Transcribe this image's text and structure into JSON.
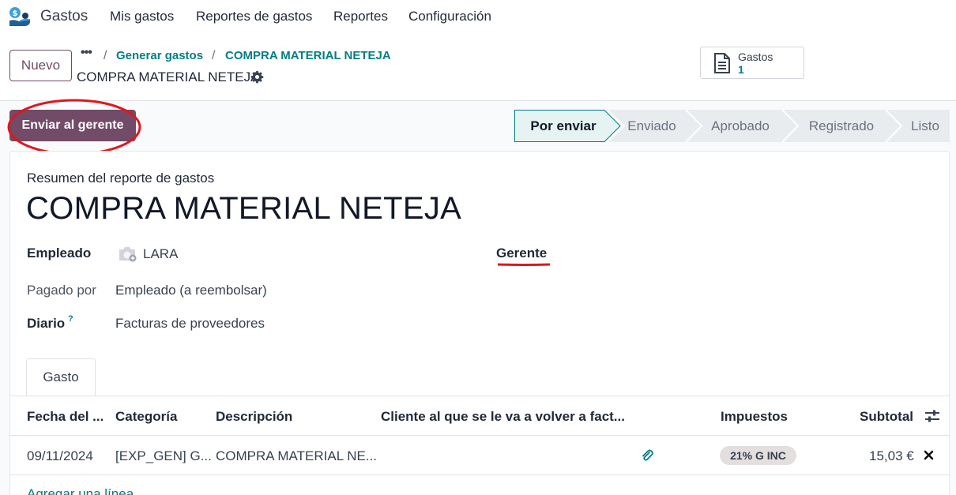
{
  "navbar": {
    "app_name": "Gastos",
    "menu": [
      "Mis gastos",
      "Reportes de gastos",
      "Reportes",
      "Configuración"
    ]
  },
  "control_panel": {
    "new_button": "Nuevo",
    "breadcrumb": {
      "more": "•••",
      "items": [
        "Generar gastos",
        "COMPRA MATERIAL NETEJA"
      ]
    },
    "record_title": "COMPRA MATERIAL NETEJA",
    "smart_button": {
      "label": "Gastos",
      "value": "1"
    }
  },
  "actions": {
    "primary_button": "Enviar al gerente"
  },
  "statusbar": {
    "steps": [
      "Por enviar",
      "Enviado",
      "Aprobado",
      "Registrado",
      "Listo"
    ],
    "active": "Por enviar"
  },
  "form": {
    "subtitle": "Resumen del reporte de gastos",
    "title": "COMPRA MATERIAL NETEJA",
    "fields": {
      "employee_label": "Empleado",
      "employee_value": "LARA",
      "manager_label": "Gerente",
      "paid_by_label": "Pagado por",
      "paid_by_value": "Empleado (a reembolsar)",
      "journal_label": "Diario",
      "journal_help": "?",
      "journal_value": "Facturas de proveedores"
    },
    "tabs": [
      "Gasto"
    ]
  },
  "table": {
    "headers": {
      "date": "Fecha del ...",
      "category": "Categoría",
      "description": "Descripción",
      "customer": "Cliente al que se le va a volver a fact...",
      "taxes": "Impuestos",
      "subtotal": "Subtotal"
    },
    "rows": [
      {
        "date": "09/11/2024",
        "category": "[EXP_GEN] G...",
        "description": "COMPRA MATERIAL NE...",
        "tax": "21% G INC",
        "subtotal": "15,03 €"
      }
    ],
    "add_line": "Agregar una línea"
  },
  "colors": {
    "brand": "#714b67",
    "link": "#017e84",
    "annotation": "#e0161c"
  }
}
